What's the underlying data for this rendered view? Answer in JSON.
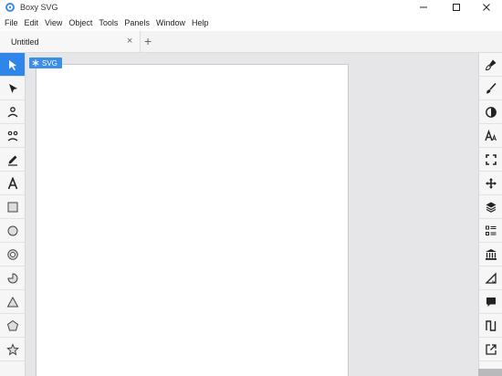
{
  "window": {
    "title": "Boxy SVG",
    "minimize_icon": "minimize-icon",
    "maximize_icon": "maximize-icon",
    "close_icon": "close-icon"
  },
  "menu": [
    "File",
    "Edit",
    "View",
    "Object",
    "Tools",
    "Panels",
    "Window",
    "Help"
  ],
  "tabs": {
    "active": "Untitled",
    "close_symbol": "×",
    "new_symbol": "+"
  },
  "canvas": {
    "badge_label": "SVG",
    "badge_color": "#3a8ee6",
    "artboard_color": "#ffffff"
  },
  "left_tools": [
    "selection-arrow-icon",
    "node-arrow-icon",
    "user-single-icon",
    "users-pair-icon",
    "pencil-icon",
    "text-icon",
    "rectangle-icon",
    "ellipse-icon",
    "ring-icon",
    "pie-icon",
    "triangle-icon",
    "pentagon-icon",
    "star-icon"
  ],
  "right_panels": [
    "fill-brush-icon",
    "stroke-brush-icon",
    "contrast-icon",
    "typography-icon",
    "fullscreen-icon",
    "move-icon",
    "layers-icon",
    "list-icon",
    "library-icon",
    "ruler-triangle-icon",
    "comment-icon",
    "path-wave-icon",
    "export-icon"
  ],
  "accent_color": "#2f86e8"
}
